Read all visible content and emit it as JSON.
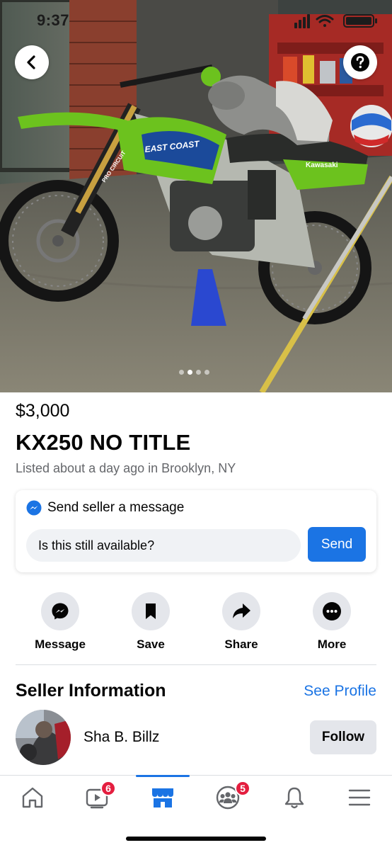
{
  "status_bar": {
    "time": "9:37"
  },
  "hero": {
    "photo_text": [
      "EAST COAST",
      "Kawasaki",
      "PRO CIRCUIT"
    ],
    "image_count": 4,
    "active_index": 1
  },
  "listing": {
    "price": "$3,000",
    "title": "KX250 NO TITLE",
    "listed": "Listed about a day ago in Brooklyn, NY"
  },
  "message_card": {
    "heading": "Send seller a message",
    "input_value": "Is this still available?",
    "send_label": "Send"
  },
  "actions": [
    {
      "label": "Message",
      "icon": "messenger-icon"
    },
    {
      "label": "Save",
      "icon": "bookmark-icon"
    },
    {
      "label": "Share",
      "icon": "share-arrow-icon"
    },
    {
      "label": "More",
      "icon": "more-dots-icon"
    }
  ],
  "seller": {
    "heading": "Seller Information",
    "see_profile": "See Profile",
    "name": "Sha B. Billz",
    "follow_label": "Follow"
  },
  "bottom_nav": {
    "items": [
      {
        "name": "home",
        "icon": "home-icon",
        "badge": ""
      },
      {
        "name": "watch",
        "icon": "video-icon",
        "badge": "6"
      },
      {
        "name": "marketplace",
        "icon": "marketplace-store-icon",
        "badge": ""
      },
      {
        "name": "groups",
        "icon": "groups-icon",
        "badge": "5"
      },
      {
        "name": "notifications",
        "icon": "bell-icon",
        "badge": ""
      },
      {
        "name": "menu",
        "icon": "hamburger-menu-icon",
        "badge": ""
      }
    ],
    "active": "marketplace"
  },
  "colors": {
    "accent": "#1b74e4",
    "badge": "#e41e3f",
    "button_bg": "#e4e6eb",
    "text_secondary": "#65676b",
    "bike_green": "#6cc21e"
  }
}
